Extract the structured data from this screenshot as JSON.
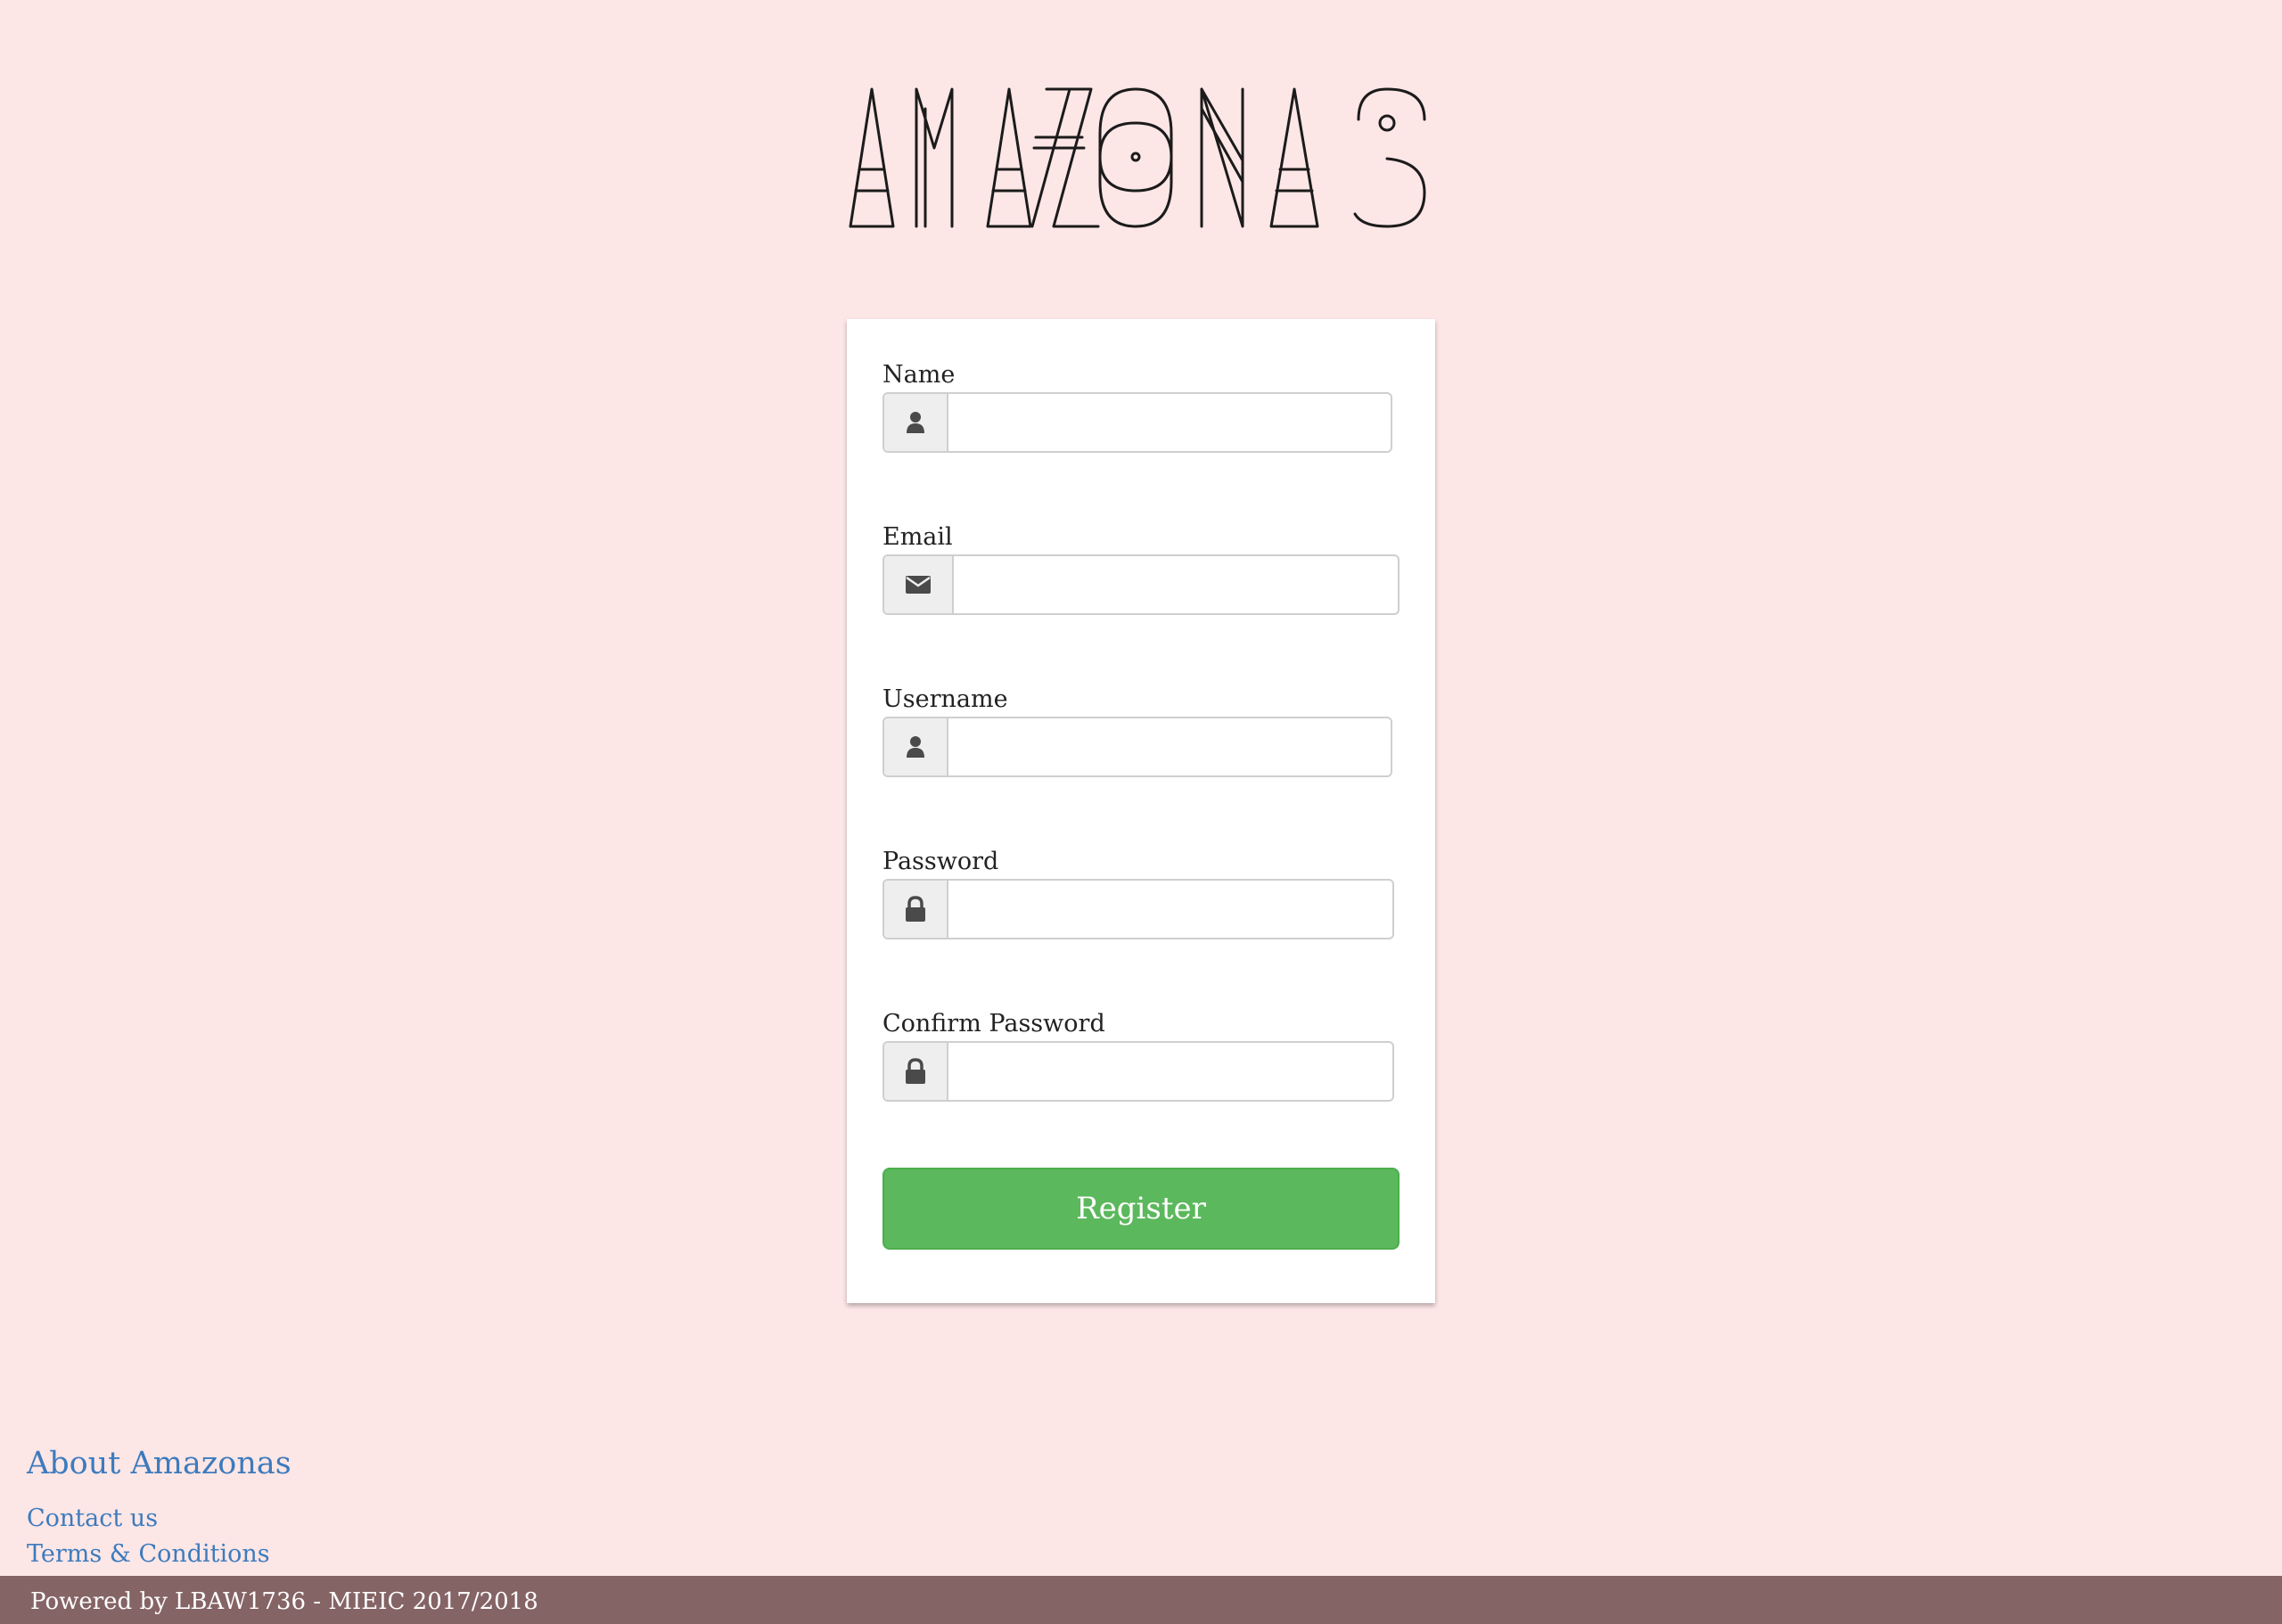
{
  "brand": {
    "logo_text": "AMAZONAS"
  },
  "form": {
    "fields": [
      {
        "label": "Name",
        "value": "",
        "icon": "user-icon"
      },
      {
        "label": "Email",
        "value": "",
        "icon": "envelope-icon"
      },
      {
        "label": "Username",
        "value": "",
        "icon": "user-icon"
      },
      {
        "label": "Password",
        "value": "",
        "icon": "lock-icon"
      },
      {
        "label": "Confirm Password",
        "value": "",
        "icon": "lock-icon"
      }
    ],
    "submit_label": "Register"
  },
  "footer": {
    "about_title": "About Amazonas",
    "links": [
      "Contact us",
      "Terms & Conditions"
    ],
    "powered_by": "Powered by LBAW1736 - MIEIC 2017/2018"
  },
  "colors": {
    "background": "#fde6e6",
    "button": "#5cb85c",
    "link": "#3d7bbd",
    "footer_bar": "#856466"
  }
}
